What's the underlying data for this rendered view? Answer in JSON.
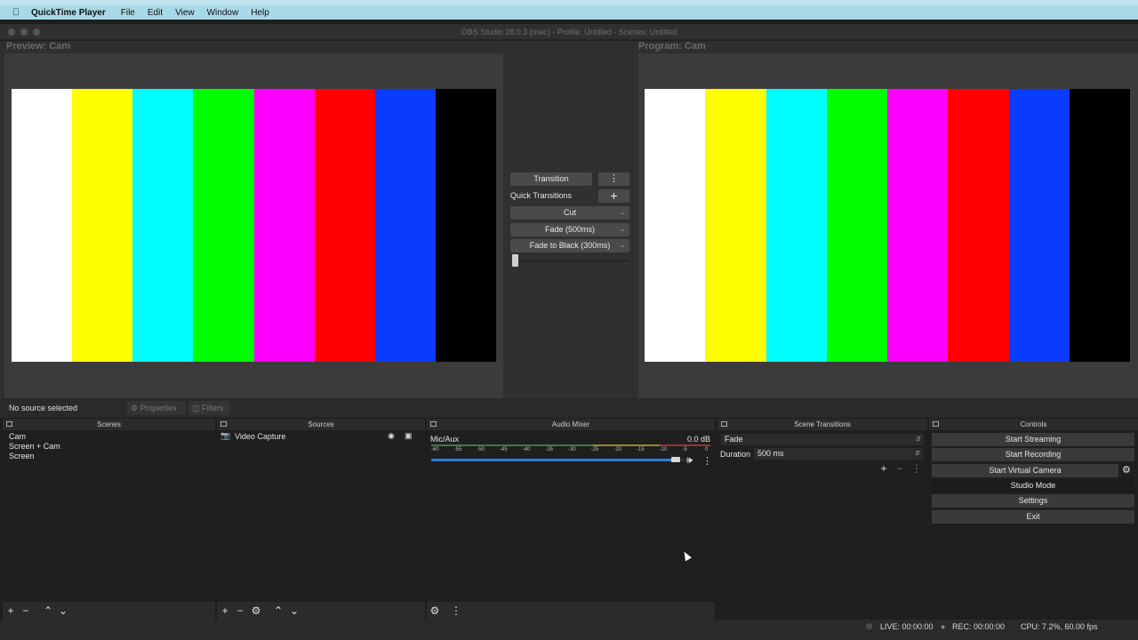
{
  "menubar": {
    "app_name": "QuickTime Player",
    "items": [
      "File",
      "Edit",
      "View",
      "Window",
      "Help"
    ]
  },
  "window": {
    "title": "OBS Studio 28.0.3 (mac) - Profile: Untitled - Scenes: Untitled"
  },
  "preview": {
    "label": "Preview: Cam"
  },
  "program": {
    "label": "Program: Cam"
  },
  "color_bars": [
    "#ffffff",
    "#fefe00",
    "#00fefe",
    "#00fe00",
    "#fe00fe",
    "#fe0000",
    "#0a3cff",
    "#000000"
  ],
  "transitions": {
    "transition_button": "Transition",
    "quick_transitions_label": "Quick Transitions",
    "options": [
      "Cut",
      "Fade (500ms)",
      "Fade to Black (300ms)"
    ]
  },
  "source_toolbar": {
    "no_source": "No source selected",
    "properties": "Properties",
    "filters": "Filters"
  },
  "scenes": {
    "title": "Scenes",
    "items": [
      "Cam",
      "Screen + Cam",
      "Screen"
    ]
  },
  "sources": {
    "title": "Sources",
    "items": [
      "Video Capture"
    ]
  },
  "audio_mixer": {
    "title": "Audio Mixer",
    "channel": "Mic/Aux",
    "db": "0.0 dB",
    "scale": [
      "-60",
      "-55",
      "-50",
      "-45",
      "-40",
      "-35",
      "-30",
      "-25",
      "-20",
      "-15",
      "-10",
      "-5",
      "0"
    ],
    "volume_level": 0.98
  },
  "scene_transitions": {
    "title": "Scene Transitions",
    "selected": "Fade",
    "duration_label": "Duration",
    "duration_value": "500 ms"
  },
  "controls": {
    "title": "Controls",
    "start_streaming": "Start Streaming",
    "start_recording": "Start Recording",
    "start_virtual_camera": "Start Virtual Camera",
    "studio_mode": "Studio Mode",
    "settings": "Settings",
    "exit": "Exit"
  },
  "status": {
    "live": "LIVE: 00:00:00",
    "rec": "REC: 00:00:00",
    "cpu": "CPU: 7.2%, 60.00 fps"
  }
}
